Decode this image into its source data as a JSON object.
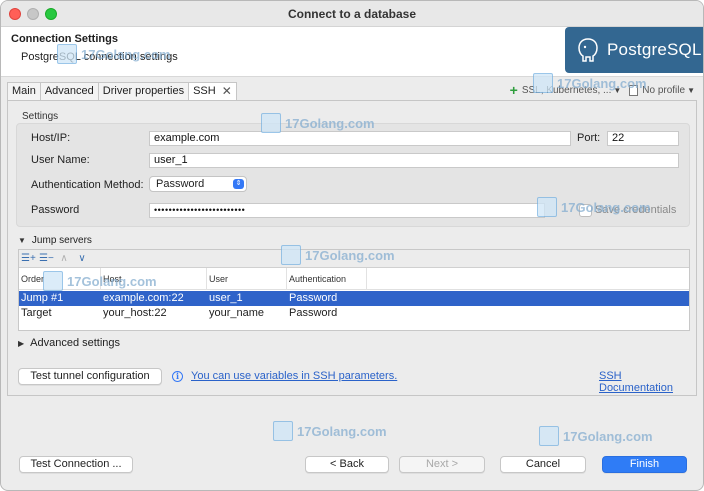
{
  "window": {
    "title": "Connect to a database"
  },
  "header": {
    "title": "Connection Settings",
    "subtitle": "PostgreSQL connection settings",
    "logo_text": "PostgreSQL"
  },
  "tabs": [
    {
      "label": "Main"
    },
    {
      "label": "Advanced"
    },
    {
      "label": "Driver properties"
    },
    {
      "label": "SSH"
    }
  ],
  "toolbar_right": {
    "network_label": "SSL, Kubernetes, ...",
    "profile_label": "No profile"
  },
  "settings": {
    "group_label": "Settings",
    "host_label": "Host/IP:",
    "host_value": "example.com",
    "port_label": "Port:",
    "port_value": "22",
    "user_label": "User Name:",
    "user_value": "user_1",
    "auth_label": "Authentication Method:",
    "auth_value": "Password",
    "password_label": "Password",
    "password_mask": "•••••••••••••••••••••••••",
    "save_credentials_label": "Save credentials"
  },
  "jump_servers": {
    "label": "Jump servers",
    "columns": [
      "Order",
      "Host",
      "User",
      "Authentication"
    ],
    "rows": [
      {
        "order": "Jump #1",
        "host": "example.com:22",
        "user": "user_1",
        "auth": "Password",
        "selected": true
      },
      {
        "order": "Target",
        "host": "your_host:22",
        "user": "your_name",
        "auth": "Password",
        "selected": false
      }
    ]
  },
  "advanced_settings": {
    "label": "Advanced settings"
  },
  "actions": {
    "test_tunnel_label": "Test tunnel configuration",
    "variables_link": "You can use variables in SSH parameters.",
    "ssh_docs_link": "SSH Documentation"
  },
  "footer": {
    "test_connection": "Test Connection ...",
    "back": "< Back",
    "next": "Next >",
    "cancel": "Cancel",
    "finish": "Finish"
  },
  "watermark_text": "17Golang.com",
  "colors": {
    "accent": "#2f7cf6",
    "selection": "#2f63c9",
    "postgres_blue": "#336791",
    "add_green": "#2e9e3d"
  }
}
